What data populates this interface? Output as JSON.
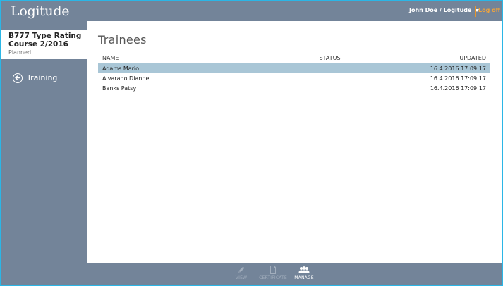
{
  "header": {
    "logo": "Logitude",
    "user": "John Doe / Logitude",
    "logoff": "Log off"
  },
  "sidebar": {
    "course_title": "B777 Type Rating Course 2/2016",
    "course_status": "Planned",
    "nav_label": "Training",
    "nav_icon": "arrow-left-circle-icon"
  },
  "main": {
    "title": "Trainees",
    "columns": [
      "NAME",
      "STATUS",
      "UPDATED"
    ],
    "rows": [
      {
        "name": "Adams Mario",
        "status": "",
        "updated": "16.4.2016 17:09:17",
        "selected": true
      },
      {
        "name": "Alvarado Dianne",
        "status": "",
        "updated": "16.4.2016 17:09:17",
        "selected": false
      },
      {
        "name": "Banks Patsy",
        "status": "",
        "updated": "16.4.2016 17:09:17",
        "selected": false
      }
    ]
  },
  "toolbar": {
    "view": {
      "label": "VIEW",
      "icon": "pencil-icon",
      "enabled": false
    },
    "certificate": {
      "label": "CERTIFICATE",
      "icon": "document-icon",
      "enabled": false
    },
    "manage": {
      "label": "MANAGE",
      "icon": "users-icon",
      "enabled": true
    }
  },
  "colors": {
    "frame": "#2bb6e6",
    "bars": "#738499",
    "accent": "#f0a33c",
    "selected_row": "#a9c6d6"
  }
}
